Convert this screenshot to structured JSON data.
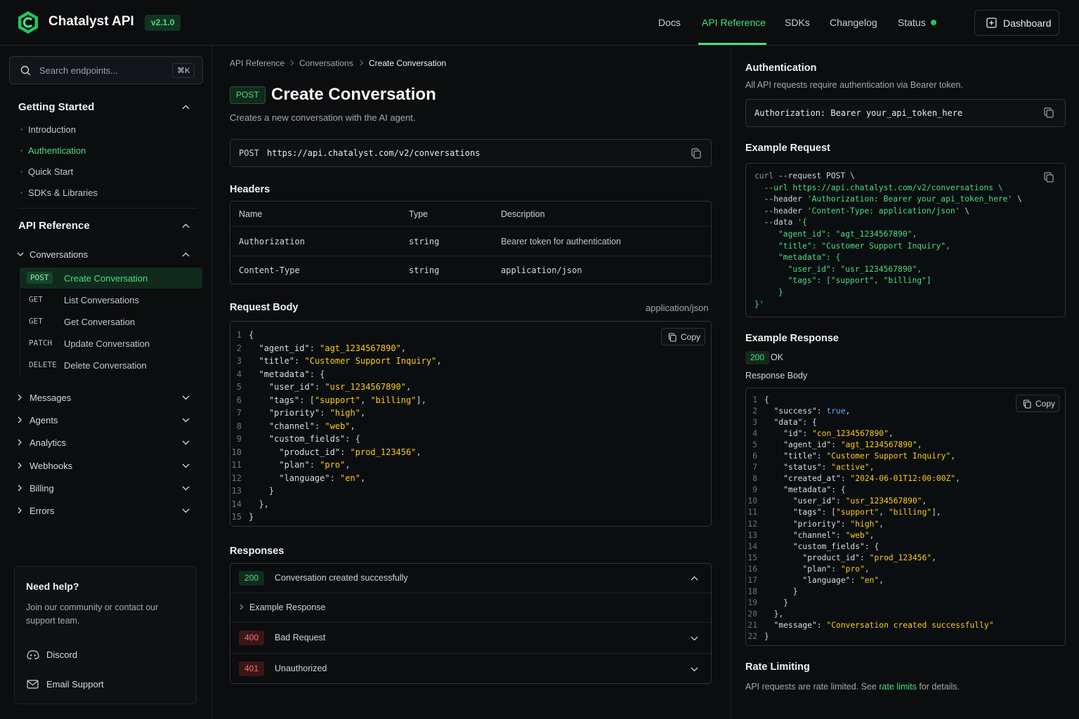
{
  "header": {
    "brand": "Chatalyst API",
    "version": "v2.1.0",
    "nav": [
      "Docs",
      "API Reference",
      "SDKs",
      "Changelog",
      "Status"
    ],
    "active_nav": "API Reference",
    "dashboard_label": "Dashboard"
  },
  "colors": {
    "accent": "#4ade80",
    "error": "#f87171",
    "background": "#0b0d0f"
  },
  "sidebar": {
    "search_placeholder": "Search endpoints...",
    "search_shortcut": "⌘K",
    "getting_started": {
      "title": "Getting Started",
      "items": [
        "Introduction",
        "Authentication",
        "Quick Start",
        "SDKs & Libraries"
      ],
      "active": "Authentication"
    },
    "api_reference": {
      "title": "API Reference",
      "group": "Conversations",
      "endpoints": [
        {
          "method": "POST",
          "label": "Create Conversation",
          "active": true
        },
        {
          "method": "GET",
          "label": "List Conversations"
        },
        {
          "method": "GET",
          "label": "Get Conversation"
        },
        {
          "method": "PATCH",
          "label": "Update Conversation"
        },
        {
          "method": "DELETE",
          "label": "Delete Conversation"
        }
      ]
    },
    "categories": [
      "Messages",
      "Agents",
      "Analytics",
      "Webhooks",
      "Billing",
      "Errors"
    ],
    "help": {
      "title": "Need help?",
      "text": "Join our community or contact our support team.",
      "links": [
        "Discord",
        "Email Support"
      ]
    }
  },
  "main": {
    "breadcrumb": [
      "API Reference",
      "Conversations",
      "Create Conversation"
    ],
    "method": "POST",
    "title": "Create Conversation",
    "description": "Creates a new conversation with the AI agent.",
    "endpoint_method": "POST",
    "endpoint_url": "https://api.chatalyst.com/v2/conversations",
    "headers_title": "Headers",
    "headers_columns": [
      "Name",
      "Type",
      "Description"
    ],
    "headers_rows": [
      {
        "name": "Authorization",
        "type": "string",
        "description": "Bearer token for authentication"
      },
      {
        "name": "Content-Type",
        "type": "string",
        "description": "application/json"
      }
    ],
    "request_body_title": "Request Body",
    "request_body_type": "application/json",
    "copy_label": "Copy",
    "request_body_code": [
      "{",
      "  \"agent_id\": \"agt_1234567890\",",
      "  \"title\": \"Customer Support Inquiry\",",
      "  \"metadata\": {",
      "    \"user_id\": \"usr_1234567890\",",
      "    \"tags\": [\"support\", \"billing\"],",
      "    \"priority\": \"high\",",
      "    \"channel\": \"web\",",
      "    \"custom_fields\": {",
      "      \"product_id\": \"prod_123456\",",
      "      \"plan\": \"pro\",",
      "      \"language\": \"en\",",
      "    }",
      "  },",
      "}"
    ],
    "responses_title": "Responses",
    "responses": [
      {
        "code": "200",
        "text": "Conversation created successfully",
        "expanded": true
      },
      {
        "code": "400",
        "text": "Bad Request"
      },
      {
        "code": "401",
        "text": "Unauthorized"
      }
    ],
    "example_response_label": "Example Response"
  },
  "right": {
    "auth_title": "Authentication",
    "auth_text": "All API requests require authentication via Bearer token.",
    "auth_code": "Authorization: Bearer your_api_token_here",
    "example_request_title": "Example Request",
    "example_request_code": [
      "curl --request POST \\",
      "  --url https://api.chatalyst.com/v2/conversations \\",
      "  --header 'Authorization: Bearer your_api_token_here' \\",
      "  --header 'Content-Type: application/json' \\",
      "  --data '{",
      "     \"agent_id\": \"agt_1234567890\",",
      "     \"title\": \"Customer Support Inquiry\",",
      "     \"metadata\": {",
      "       \"user_id\": \"usr_1234567890\",",
      "       \"tags\": [\"support\", \"billing\"]",
      "     }",
      "}'"
    ],
    "example_response_title": "Example Response",
    "status_code": "200",
    "status_text": "OK",
    "response_body_label": "Response Body",
    "response_code": [
      "{",
      "  \"success\": true,",
      "  \"data\": {",
      "    \"id\": \"con_1234567890\",",
      "    \"agent_id\": \"agt_1234567890\",",
      "    \"title\": \"Customer Support Inquiry\",",
      "    \"status\": \"active\",",
      "    \"created_at\": \"2024-06-01T12:00:00Z\",",
      "    \"metadata\": {",
      "      \"user_id\": \"usr_1234567890\",",
      "      \"tags\": [\"support\", \"billing\"],",
      "      \"priority\": \"high\",",
      "      \"channel\": \"web\",",
      "      \"custom_fields\": {",
      "        \"product_id\": \"prod_123456\",",
      "        \"plan\": \"pro\",",
      "        \"language\": \"en\",",
      "      }",
      "    }",
      "  },",
      "  \"message\": \"Conversation created successfully\"",
      "}"
    ],
    "rate_title": "Rate Limiting",
    "rate_text_before": "API requests are rate limited. See ",
    "rate_link": "rate limits",
    "rate_text_after": " for details."
  }
}
